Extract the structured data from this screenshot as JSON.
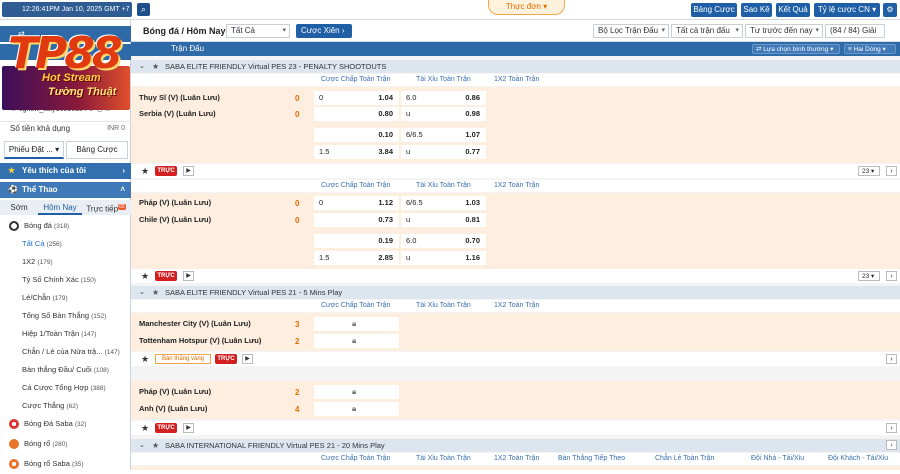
{
  "topbar": {
    "clock": "12:26:41PM Jan 10, 2025 GMT +7",
    "menu_label": "Thực đơn",
    "buttons": [
      "Bảng Cược",
      "Sao Kê",
      "Kết Quả",
      "Tỷ lệ cược CN"
    ]
  },
  "brand": {
    "logo_text": "TP88",
    "banner_line1": "Hot Stream",
    "banner_line2": "Tường Thuật"
  },
  "sidebar": {
    "account": "cgnew_ssty16896154",
    "balance_label": "Số tiền khả dụng",
    "balance_value": "INR 0",
    "slip_label": "Phiếu Đặt ...",
    "slip_tab2": "Bảng Cược",
    "favorites": "Yêu thích của tôi",
    "sports_header": "Thể Thao",
    "subtabs": [
      "Sớm",
      "Hôm Nay",
      "Trực tiếp"
    ],
    "live_badge": "65",
    "soccer": {
      "label": "Bóng đá",
      "count": "(318)"
    },
    "items": [
      {
        "label": "Tất Cả",
        "count": "(256)"
      },
      {
        "label": "1X2",
        "count": "(179)"
      },
      {
        "label": "Tỷ Số Chính Xác",
        "count": "(150)"
      },
      {
        "label": "Lẻ/Chẵn",
        "count": "(179)"
      },
      {
        "label": "Tổng Số Bàn Thắng",
        "count": "(152)"
      },
      {
        "label": "Hiệp 1/Toàn Trận",
        "count": "(147)"
      },
      {
        "label": "Chẵn / Lẻ của Nửa trậ...",
        "count": "(147)"
      },
      {
        "label": "Bàn thắng Đầu/ Cuối",
        "count": "(108)"
      },
      {
        "label": "Cá Cược Tổng Hợp",
        "count": "(388)"
      },
      {
        "label": "Cược Thắng",
        "count": "(62)"
      }
    ],
    "others": [
      {
        "label": "Bóng Đá Saba",
        "count": "(32)"
      },
      {
        "label": "Bóng rổ",
        "count": "(280)"
      },
      {
        "label": "Bóng rổ Saba",
        "count": "(35)"
      }
    ]
  },
  "header": {
    "title": "Bóng đá / Hôm Nay",
    "filter": "Tất Cả",
    "xien": "Cược Xiên",
    "filter_match": "Bộ Lọc Trận Đấu",
    "all_matches": "Tất cả trận đấu",
    "sort": "Tư trước đến nay",
    "count": "(84 / 84) Giải",
    "sub_title": "Trận Đấu",
    "choose_odds": "Lựa chọn bình thường",
    "two_rows": "Hai Dòng"
  },
  "colheaders": {
    "handicap": "Cược Chấp Toàn Trận",
    "overunder": "Tài Xỉu Toàn Trận",
    "onextwo": "1X2 Toàn Trận",
    "next_goal": "Bàn Thắng Tiếp Theo",
    "oddeven": "Chẵn Lẻ Toàn Trận",
    "home_ou": "Đội Nhà - Tài/Xỉu",
    "away_ou": "Đội Khách - Tài/Xỉu"
  },
  "leagues": [
    {
      "name": "SABA ELITE FRIENDLY Virtual PES 23 - PENALTY SHOOTOUTS"
    },
    {
      "name": "SABA ELITE FRIENDLY Virtual PES 21 - 5 Mins Play"
    },
    {
      "name": "SABA INTERNATIONAL FRIENDLY Virtual PES 21 - 20 Mins Play"
    }
  ],
  "matches": [
    {
      "home": "Thụy Sĩ (V) (Luân Lưu)",
      "away": "Serbia (V) (Luân Lưu)",
      "home_score": "0",
      "away_score": "0",
      "rows": [
        [
          "0",
          "1.04",
          "6.0",
          "0.86"
        ],
        [
          "",
          "0.80",
          "u",
          "0.98"
        ],
        [
          "",
          "0.10",
          "6/6.5",
          "1.07"
        ],
        [
          "1.5",
          "3.84",
          "u",
          "0.77"
        ]
      ],
      "live": "TRỰC",
      "count": "23"
    },
    {
      "home": "Pháp (V) (Luân Lưu)",
      "away": "Chile (V) (Luân Lưu)",
      "home_score": "0",
      "away_score": "0",
      "rows": [
        [
          "0",
          "1.12",
          "6/6.5",
          "1.03"
        ],
        [
          "",
          "0.73",
          "u",
          "0.81"
        ],
        [
          "",
          "0.19",
          "6.0",
          "0.70"
        ],
        [
          "1.5",
          "2.85",
          "u",
          "1.16"
        ]
      ],
      "live": "TRỰC",
      "count": "23"
    },
    {
      "home": "Manchester City (V) (Luân Lưu)",
      "away": "Tottenham Hotspur (V) (Luân Lưu)",
      "home_score": "3",
      "away_score": "2",
      "tag": "Bàn thắng vàng",
      "live": "TRỰC"
    },
    {
      "home": "Pháp (V) (Luân Lưu)",
      "away": "Anh (V) (Luân Lưu)",
      "home_score": "2",
      "away_score": "4",
      "live": "TRỰC"
    }
  ]
}
